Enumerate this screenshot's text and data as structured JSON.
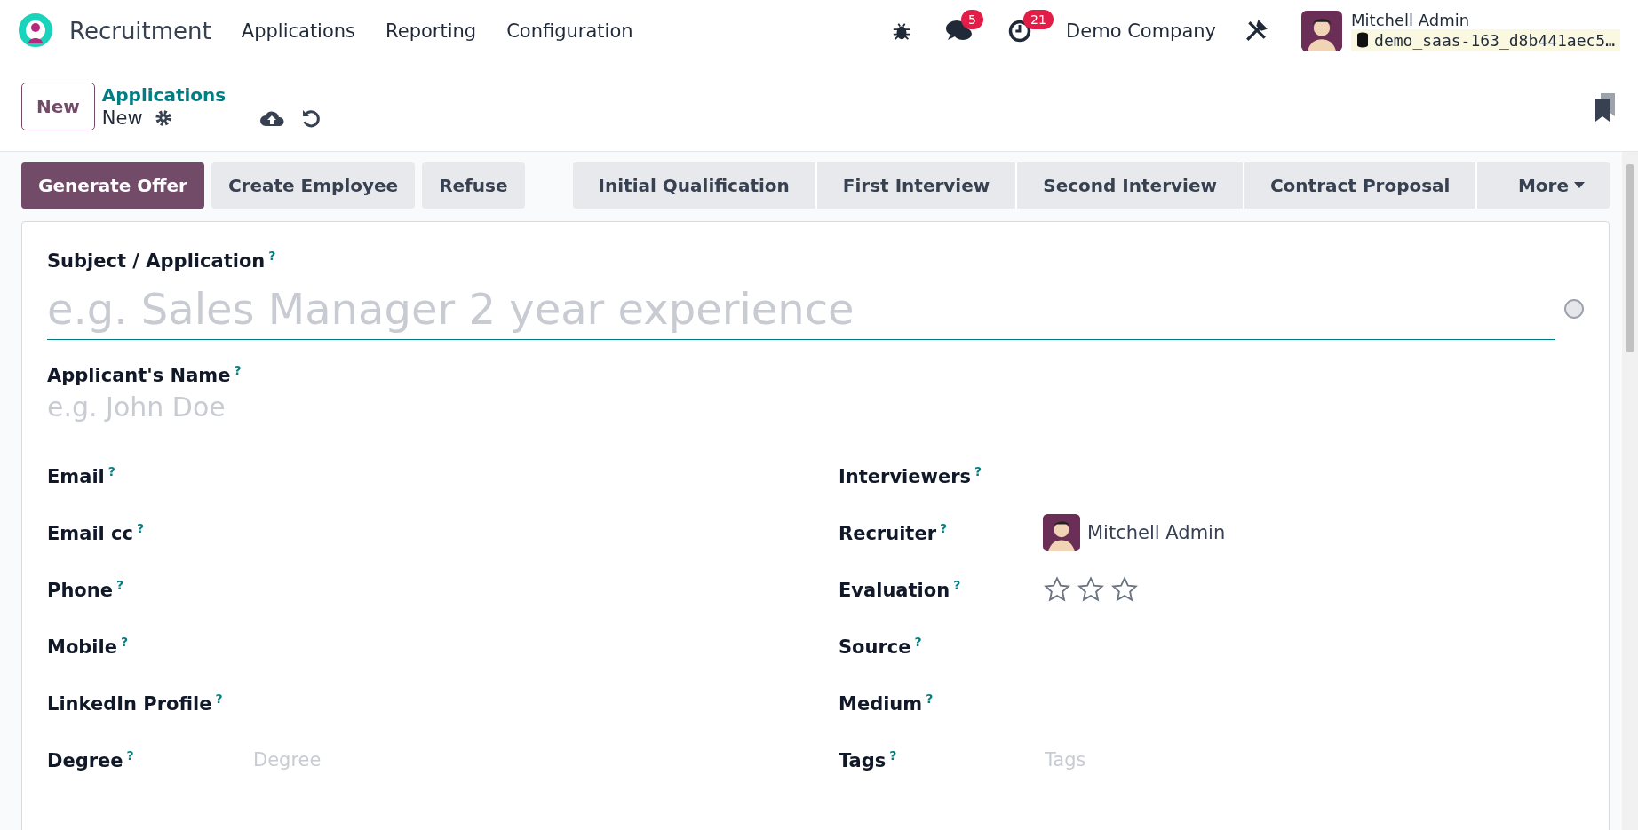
{
  "app": {
    "name": "Recruitment"
  },
  "menu": [
    "Applications",
    "Reporting",
    "Configuration"
  ],
  "systray": {
    "messages_count": "5",
    "activities_count": "21",
    "company": "Demo Company",
    "user_name": "Mitchell Admin",
    "database": "demo_saas-163_d8b441aec5…"
  },
  "control_panel": {
    "new_button": "New",
    "breadcrumb": "Applications",
    "record": "New"
  },
  "actions": [
    {
      "label": "Generate Offer",
      "primary": true
    },
    {
      "label": "Create Employee",
      "primary": false
    },
    {
      "label": "Refuse",
      "primary": false
    }
  ],
  "stages": [
    {
      "label": "Initial Qualification",
      "selected": false
    },
    {
      "label": "First Interview",
      "selected": false
    },
    {
      "label": "Second Interview",
      "selected": false
    },
    {
      "label": "Contract Proposal",
      "selected": false
    }
  ],
  "more": "More",
  "form": {
    "subject": {
      "label": "Subject / Application",
      "help": "?",
      "placeholder": "e.g. Sales Manager 2 year experience"
    },
    "applicant": {
      "label": "Applicant's Name",
      "help": "?",
      "placeholder": "e.g. John Doe"
    },
    "left_fields": [
      {
        "label": "Email",
        "help": "?",
        "kind": "text"
      },
      {
        "label": "Email cc",
        "help": "?",
        "kind": "text"
      },
      {
        "label": "Phone",
        "help": "?",
        "kind": "text"
      },
      {
        "label": "Mobile",
        "help": "?",
        "kind": "text"
      },
      {
        "label": "LinkedIn Profile",
        "help": "?",
        "kind": "text"
      },
      {
        "label": "Degree",
        "help": "?",
        "kind": "select",
        "placeholder": "Degree"
      }
    ],
    "right_fields": [
      {
        "label": "Interviewers",
        "help": "?",
        "kind": "text"
      },
      {
        "label": "Recruiter",
        "help": "?",
        "kind": "user",
        "value": "Mitchell Admin"
      },
      {
        "label": "Evaluation",
        "help": "?",
        "kind": "stars",
        "stars": 0
      },
      {
        "label": "Source",
        "help": "?",
        "kind": "text"
      },
      {
        "label": "Medium",
        "help": "?",
        "kind": "text"
      },
      {
        "label": "Tags",
        "help": "?",
        "kind": "select",
        "placeholder": "Tags"
      }
    ]
  }
}
